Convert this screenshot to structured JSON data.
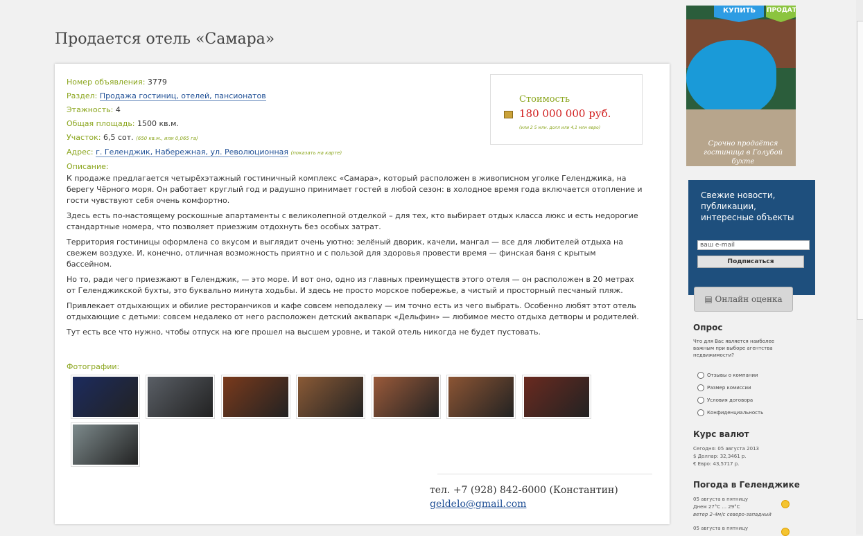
{
  "page": {
    "title": "Продается отель «Самара»"
  },
  "listing": {
    "number_label": "Номер объявления:",
    "number_value": "3779",
    "section_label": "Раздел:",
    "section_value": "Продажа гостиниц, отелей, пансионатов",
    "floors_label": "Этажность:",
    "floors_value": "4",
    "area_label": "Общая площадь:",
    "area_value": "1500 кв.м.",
    "plot_label": "Участок:",
    "plot_value": "6,5 сот.",
    "plot_note": "(650 кв.м., или 0,065 га)",
    "address_label": "Адрес:",
    "address_value": "г. Геленджик, Набережная, ул. Революционная",
    "address_note": "(показать на карте)",
    "description_label": "Описание:",
    "description": [
      "К продаже предлагается четырёхэтажный гостиничный комплекс «Самара», который расположен в живописном уголке Геленджика, на берегу Чёрного моря. Он работает круглый год и радушно принимает гостей в любой сезон: в холодное время года включается отопление и гости чувствуют себя очень комфортно.",
      "Здесь есть по-настоящему роскошные апартаменты с великолепной отделкой – для тех, кто выбирает отдых класса люкс и есть недорогие стандартные номера, что позволяет приезжим отдохнуть без особых затрат.",
      "Территория гостиницы оформлена со вкусом и выглядит очень уютно: зелёный дворик, качели, мангал — все для любителей отдыха на свежем воздухе. И, конечно, отличная возможность приятно и с пользой для здоровья провести время — финская баня с крытым бассейном.",
      "Но то, ради чего приезжают в Геленджик, — это море. И вот оно, одно из главных преимуществ этого отеля — он расположен в 20 метрах от Геленджикской бухты, это буквально минута ходьбы. И здесь не просто морское побережье, а чистый и просторный песчаный пляж.",
      "Привлекает отдыхающих и обилие ресторанчиков и кафе совсем неподалеку — им точно есть из чего выбрать. Особенно любят этот отель отдыхающие с детьми: совсем недалеко от него расположен детский аквапарк «Дельфин» — любимое место отдыха детворы и родителей.",
      "Тут есть все что нужно, чтобы отпуск на юге прошел на высшем уровне, и такой отель никогда не будет пустовать."
    ],
    "photos_label": "Фотографии:",
    "photos": [
      {
        "color": "#1c2b5e"
      },
      {
        "color": "#5a5f66"
      },
      {
        "color": "#7a3a1c"
      },
      {
        "color": "#8a5a36"
      },
      {
        "color": "#9a5a3a"
      },
      {
        "color": "#8c5534"
      },
      {
        "color": "#6a2a20"
      },
      {
        "color": "#7d8a8c"
      }
    ]
  },
  "price": {
    "label": "Стоимость",
    "value": "180 000 000 руб.",
    "sub": "(или 2 5 млн. долл или 4,1 млн евро)"
  },
  "contact": {
    "phone": "тел. +7 (928) 842-6000 (Константин)",
    "email": "geldelo@gmail.com"
  },
  "banner": {
    "tab_buy": "КУПИТЬ",
    "tab_sell": "ПРОДАТЬ",
    "caption": "Срочно продаётся гостиница в Голубой бухте"
  },
  "newsletter": {
    "text": "Свежие новости, публикации, интересные объекты",
    "input_value": "ваш e-mail",
    "button": "Подписаться"
  },
  "online_eval": {
    "label": "Онлайн оценка"
  },
  "poll": {
    "title": "Опрос",
    "question": "Что для Вас является наиболее важным при выборе агентства недвижимости?",
    "options": [
      "Отзывы о компании",
      "Размер комиссии",
      "Условия договора",
      "Конфиденциальность"
    ]
  },
  "currency": {
    "title": "Курс валют",
    "date": "Сегодня: 05 августа 2013",
    "usd": "$ Доллар: 32,3461 р.",
    "eur": "€ Евро: 43,5717 р."
  },
  "weather": {
    "title": "Погода в Геленджике",
    "day1_date": "05 августа в пятницу",
    "day1_temp": "Днем 27°С ... 29°С",
    "day1_wind": "ветер 2-4м/с северо-западный",
    "day2_date": "05 августа в пятницу"
  }
}
